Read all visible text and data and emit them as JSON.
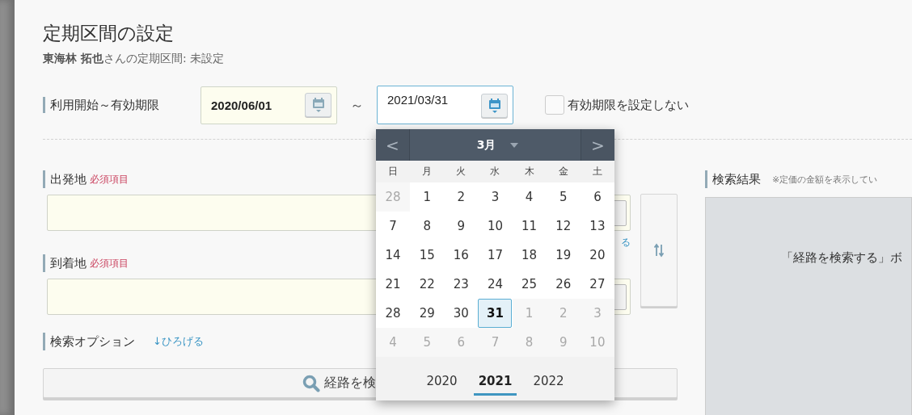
{
  "title": "定期区間の設定",
  "subtitle": "**東海林 拓也**さんの定期区間: 未設定",
  "period": {
    "label": "利用開始～有効期限",
    "start": "2020/06/01",
    "separator": "～",
    "end": "2021/03/31",
    "no_expiry": {
      "label": "有効期限を設定しない",
      "checked": false
    }
  },
  "calendar": {
    "prev": "<",
    "next": ">",
    "month": "3月",
    "weekdays": [
      "日",
      "月",
      "火",
      "水",
      "木",
      "金",
      "土"
    ],
    "weeks": [
      [
        {
          "day": "28",
          "kind": "outside",
          "selected": false
        },
        {
          "day": "1",
          "kind": "current",
          "selected": false
        },
        {
          "day": "2",
          "kind": "current",
          "selected": false
        },
        {
          "day": "3",
          "kind": "current",
          "selected": false
        },
        {
          "day": "4",
          "kind": "current",
          "selected": false
        },
        {
          "day": "5",
          "kind": "current",
          "selected": false
        },
        {
          "day": "6",
          "kind": "current",
          "selected": false
        }
      ],
      [
        {
          "day": "7",
          "kind": "current",
          "selected": false
        },
        {
          "day": "8",
          "kind": "current",
          "selected": false
        },
        {
          "day": "9",
          "kind": "current",
          "selected": false
        },
        {
          "day": "10",
          "kind": "current",
          "selected": false
        },
        {
          "day": "11",
          "kind": "current",
          "selected": false
        },
        {
          "day": "12",
          "kind": "current",
          "selected": false
        },
        {
          "day": "13",
          "kind": "current",
          "selected": false
        }
      ],
      [
        {
          "day": "14",
          "kind": "current",
          "selected": false
        },
        {
          "day": "15",
          "kind": "current",
          "selected": false
        },
        {
          "day": "16",
          "kind": "current",
          "selected": false
        },
        {
          "day": "17",
          "kind": "current",
          "selected": false
        },
        {
          "day": "18",
          "kind": "current",
          "selected": false
        },
        {
          "day": "19",
          "kind": "current",
          "selected": false
        },
        {
          "day": "20",
          "kind": "current",
          "selected": false
        }
      ],
      [
        {
          "day": "21",
          "kind": "current",
          "selected": false
        },
        {
          "day": "22",
          "kind": "current",
          "selected": false
        },
        {
          "day": "23",
          "kind": "current",
          "selected": false
        },
        {
          "day": "24",
          "kind": "current",
          "selected": false
        },
        {
          "day": "25",
          "kind": "current",
          "selected": false
        },
        {
          "day": "26",
          "kind": "current",
          "selected": false
        },
        {
          "day": "27",
          "kind": "current",
          "selected": false
        }
      ],
      [
        {
          "day": "28",
          "kind": "current",
          "selected": false
        },
        {
          "day": "29",
          "kind": "current",
          "selected": false
        },
        {
          "day": "30",
          "kind": "current",
          "selected": false
        },
        {
          "day": "31",
          "kind": "current",
          "selected": true
        },
        {
          "day": "1",
          "kind": "outside",
          "selected": false
        },
        {
          "day": "2",
          "kind": "outside",
          "selected": false
        },
        {
          "day": "3",
          "kind": "outside",
          "selected": false
        }
      ],
      [
        {
          "day": "4",
          "kind": "outside",
          "selected": false
        },
        {
          "day": "5",
          "kind": "outside",
          "selected": false
        },
        {
          "day": "6",
          "kind": "outside",
          "selected": false
        },
        {
          "day": "7",
          "kind": "outside",
          "selected": false
        },
        {
          "day": "8",
          "kind": "outside",
          "selected": false
        },
        {
          "day": "9",
          "kind": "outside",
          "selected": false
        },
        {
          "day": "10",
          "kind": "outside",
          "selected": false
        }
      ]
    ],
    "years": [
      {
        "label": "2020",
        "selected": false
      },
      {
        "label": "2021",
        "selected": true
      },
      {
        "label": "2022",
        "selected": false
      }
    ]
  },
  "departure": {
    "label": "出発地",
    "required": "必須項目",
    "link": "る"
  },
  "arrival": {
    "label": "到着地",
    "required": "必須項目"
  },
  "options": {
    "label": "検索オプション",
    "toggle": "↓ひろげる"
  },
  "search_button": "経路を検",
  "results": {
    "label": "検索結果",
    "note": "※定価の金額を表示してい",
    "message": "「経路を検索する」ボ"
  }
}
